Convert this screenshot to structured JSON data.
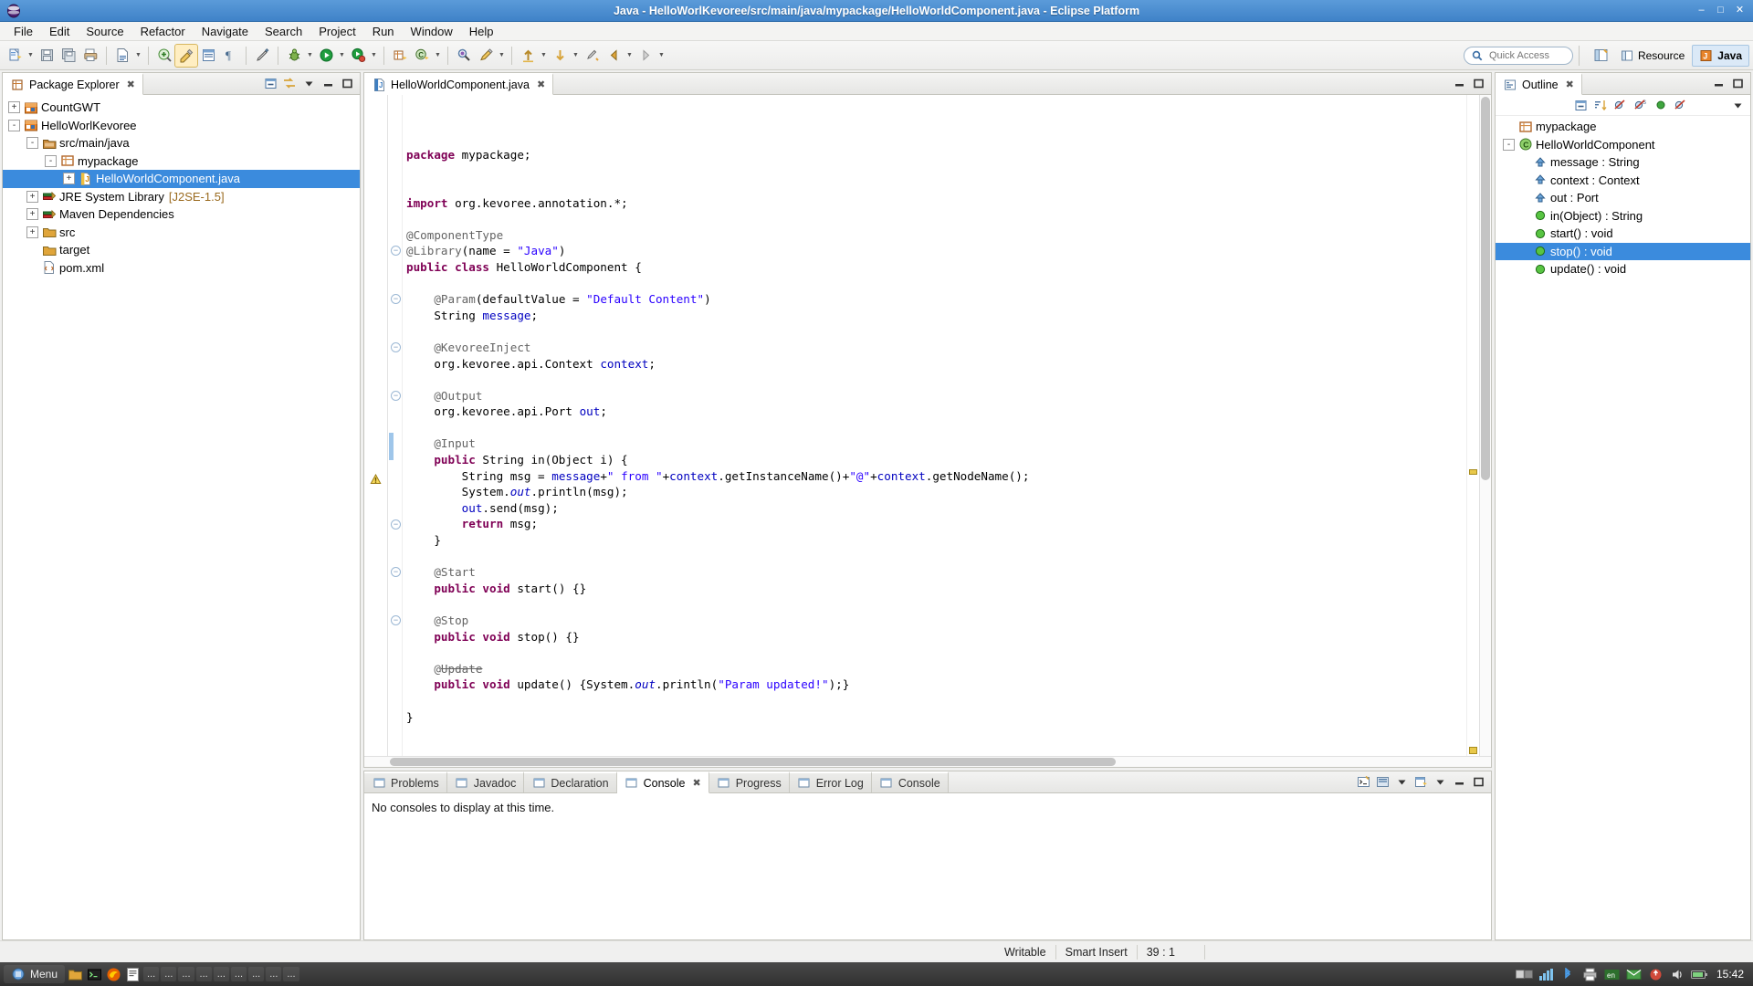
{
  "window": {
    "title": "Java - HelloWorlKevoree/src/main/java/mypackage/HelloWorldComponent.java - Eclipse Platform",
    "buttons": {
      "minimize": "–",
      "maximize": "□",
      "close": "✕"
    }
  },
  "menubar": {
    "items": [
      "File",
      "Edit",
      "Source",
      "Refactor",
      "Navigate",
      "Search",
      "Project",
      "Run",
      "Window",
      "Help"
    ]
  },
  "toolbar": {
    "quick_access_placeholder": "Quick Access",
    "perspectives": [
      {
        "label": "Resource",
        "active": false
      },
      {
        "label": "Java",
        "active": true
      }
    ]
  },
  "package_explorer": {
    "tab_label": "Package Explorer",
    "tree": [
      {
        "label": "CountGWT",
        "indent": 0,
        "toggle": "+",
        "icon": "project-icon",
        "selected": false
      },
      {
        "label": "HelloWorlKevoree",
        "indent": 0,
        "toggle": "-",
        "icon": "project-icon",
        "selected": false
      },
      {
        "label": "src/main/java",
        "indent": 1,
        "toggle": "-",
        "icon": "source-folder-icon",
        "selected": false
      },
      {
        "label": "mypackage",
        "indent": 2,
        "toggle": "-",
        "icon": "package-icon",
        "selected": false
      },
      {
        "label": "HelloWorldComponent.java",
        "indent": 3,
        "toggle": "+",
        "icon": "java-file-icon",
        "selected": true
      },
      {
        "label": "JRE System Library",
        "suffix": "[J2SE-1.5]",
        "indent": 1,
        "toggle": "+",
        "icon": "library-icon",
        "selected": false
      },
      {
        "label": "Maven Dependencies",
        "indent": 1,
        "toggle": "+",
        "icon": "library-icon",
        "selected": false
      },
      {
        "label": "src",
        "indent": 1,
        "toggle": "+",
        "icon": "folder-icon",
        "selected": false
      },
      {
        "label": "target",
        "indent": 1,
        "toggle": "",
        "icon": "folder-icon",
        "selected": false
      },
      {
        "label": "pom.xml",
        "indent": 1,
        "toggle": "",
        "icon": "xml-file-icon",
        "selected": false
      }
    ]
  },
  "editor": {
    "tab_label": "HelloWorldComponent.java",
    "lines": [
      [
        {
          "t": "package ",
          "c": "kw"
        },
        {
          "t": "mypackage;",
          "c": ""
        }
      ],
      [],
      [],
      [
        {
          "t": "import ",
          "c": "kw"
        },
        {
          "t": "org.kevoree.annotation.*;",
          "c": ""
        }
      ],
      [],
      [
        {
          "t": "@ComponentType",
          "c": "ann"
        }
      ],
      [
        {
          "t": "@Library",
          "c": "ann"
        },
        {
          "t": "(name = ",
          "c": ""
        },
        {
          "t": "\"Java\"",
          "c": "str"
        },
        {
          "t": ")",
          "c": ""
        }
      ],
      [
        {
          "t": "public class ",
          "c": "kw"
        },
        {
          "t": "HelloWorldComponent {",
          "c": ""
        }
      ],
      [],
      [
        {
          "t": "    @Param",
          "c": "ann"
        },
        {
          "t": "(defaultValue = ",
          "c": ""
        },
        {
          "t": "\"Default Content\"",
          "c": "str"
        },
        {
          "t": ")",
          "c": ""
        }
      ],
      [
        {
          "t": "    String ",
          "c": ""
        },
        {
          "t": "message",
          "c": "fld"
        },
        {
          "t": ";",
          "c": ""
        }
      ],
      [],
      [
        {
          "t": "    @KevoreeInject",
          "c": "ann"
        }
      ],
      [
        {
          "t": "    org.kevoree.api.Context ",
          "c": ""
        },
        {
          "t": "context",
          "c": "fld"
        },
        {
          "t": ";",
          "c": ""
        }
      ],
      [],
      [
        {
          "t": "    @Output",
          "c": "ann"
        }
      ],
      [
        {
          "t": "    org.kevoree.api.Port ",
          "c": ""
        },
        {
          "t": "out",
          "c": "fld"
        },
        {
          "t": ";",
          "c": ""
        }
      ],
      [],
      [
        {
          "t": "    @Input",
          "c": "ann"
        }
      ],
      [
        {
          "t": "    public ",
          "c": "kw"
        },
        {
          "t": "String in(Object i) {",
          "c": ""
        }
      ],
      [
        {
          "t": "        String msg = ",
          "c": ""
        },
        {
          "t": "message",
          "c": "fld"
        },
        {
          "t": "+",
          "c": ""
        },
        {
          "t": "\" from \"",
          "c": "str"
        },
        {
          "t": "+",
          "c": ""
        },
        {
          "t": "context",
          "c": "fld"
        },
        {
          "t": ".getInstanceName()+",
          "c": ""
        },
        {
          "t": "\"@\"",
          "c": "str"
        },
        {
          "t": "+",
          "c": ""
        },
        {
          "t": "context",
          "c": "fld"
        },
        {
          "t": ".getNodeName();",
          "c": ""
        }
      ],
      [
        {
          "t": "        System.",
          "c": ""
        },
        {
          "t": "out",
          "c": "sfld"
        },
        {
          "t": ".println(msg);",
          "c": ""
        }
      ],
      [
        {
          "t": "        ",
          "c": ""
        },
        {
          "t": "out",
          "c": "fld"
        },
        {
          "t": ".send(msg);",
          "c": ""
        }
      ],
      [
        {
          "t": "        return ",
          "c": "kw"
        },
        {
          "t": "msg;",
          "c": ""
        }
      ],
      [
        {
          "t": "    }",
          "c": ""
        }
      ],
      [],
      [
        {
          "t": "    @Start",
          "c": "ann"
        }
      ],
      [
        {
          "t": "    public void ",
          "c": "kw"
        },
        {
          "t": "start() {}",
          "c": ""
        }
      ],
      [],
      [
        {
          "t": "    @Stop",
          "c": "ann"
        }
      ],
      [
        {
          "t": "    public void ",
          "c": "kw"
        },
        {
          "t": "stop() {}",
          "c": ""
        }
      ],
      [],
      [
        {
          "t": "    @",
          "c": "ann"
        },
        {
          "t": "Update",
          "c": "strike"
        }
      ],
      [
        {
          "t": "    public void ",
          "c": "kw"
        },
        {
          "t": "update() {System.",
          "c": ""
        },
        {
          "t": "out",
          "c": "sfld"
        },
        {
          "t": ".println(",
          "c": ""
        },
        {
          "t": "\"Param updated!\"",
          "c": "str"
        },
        {
          "t": ");}",
          "c": ""
        }
      ],
      [],
      [
        {
          "t": "}",
          "c": ""
        }
      ]
    ],
    "fold_lines": [
      9,
      12,
      15,
      18,
      26,
      29,
      32
    ],
    "highlighted_line_index": 36,
    "changed_bar_lines": [
      29,
      30
    ],
    "warning_line": 32
  },
  "outline": {
    "tab_label": "Outline",
    "items": [
      {
        "label": "mypackage",
        "icon": "package-icon",
        "indent": 0,
        "selected": false
      },
      {
        "label": "HelloWorldComponent",
        "icon": "class-icon",
        "indent": 0,
        "toggle": "-",
        "selected": false
      },
      {
        "label": "message : String",
        "icon": "field-icon",
        "indent": 1,
        "selected": false
      },
      {
        "label": "context : Context",
        "icon": "field-icon",
        "indent": 1,
        "selected": false
      },
      {
        "label": "out : Port",
        "icon": "field-icon",
        "indent": 1,
        "selected": false
      },
      {
        "label": "in(Object) : String",
        "icon": "method-icon",
        "indent": 1,
        "selected": false
      },
      {
        "label": "start() : void",
        "icon": "method-icon",
        "indent": 1,
        "selected": false
      },
      {
        "label": "stop() : void",
        "icon": "method-icon",
        "indent": 1,
        "selected": true
      },
      {
        "label": "update() : void",
        "icon": "method-icon",
        "indent": 1,
        "selected": false
      }
    ]
  },
  "bottom_panel": {
    "tabs": [
      {
        "label": "Problems",
        "icon": "problems-icon",
        "selected": false
      },
      {
        "label": "Javadoc",
        "icon": "javadoc-icon",
        "selected": false
      },
      {
        "label": "Declaration",
        "icon": "declaration-icon",
        "selected": false
      },
      {
        "label": "Console",
        "icon": "console-icon",
        "selected": true
      },
      {
        "label": "Progress",
        "icon": "progress-icon",
        "selected": false
      },
      {
        "label": "Error Log",
        "icon": "errorlog-icon",
        "selected": false
      },
      {
        "label": "Console",
        "icon": "console-icon",
        "selected": false
      }
    ],
    "message": "No consoles to display at this time."
  },
  "statusbar": {
    "writable": "Writable",
    "insert_mode": "Smart Insert",
    "position": "39 : 1"
  },
  "taskbar": {
    "menu_label": "Menu",
    "windows": [
      "...",
      "...",
      "...",
      "...",
      "...",
      "...",
      "...",
      "...",
      "..."
    ],
    "clock": "15:42"
  },
  "colors": {
    "title_bar": "#4a8ccc",
    "selection": "#3b8bdd",
    "keyword": "#7f0055",
    "string": "#2a00ff",
    "annotation": "#646464",
    "field": "#0000c0",
    "highlight_line": "#e8f2fd"
  }
}
